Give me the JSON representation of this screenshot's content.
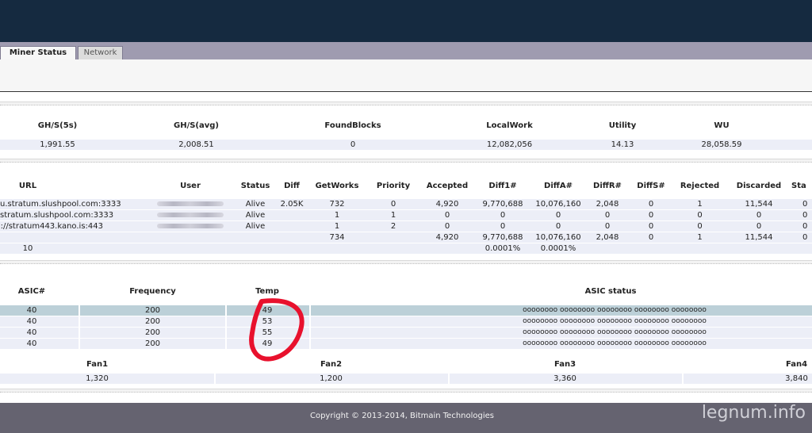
{
  "tabs": [
    {
      "label": "Miner Status",
      "active": true
    },
    {
      "label": "Network",
      "active": false
    }
  ],
  "summary": {
    "headers": [
      "GH/S(5s)",
      "GH/S(avg)",
      "FoundBlocks",
      "LocalWork",
      "Utility",
      "WU"
    ],
    "values": [
      "1,991.55",
      "2,008.51",
      "0",
      "12,082,056",
      "14.13",
      "28,058.59"
    ]
  },
  "pools": {
    "headers": [
      "URL",
      "User",
      "Status",
      "Diff",
      "GetWorks",
      "Priority",
      "Accepted",
      "Diff1#",
      "DiffA#",
      "DiffR#",
      "DiffS#",
      "Rejected",
      "Discarded",
      "Sta"
    ],
    "rows": [
      {
        "url": "u.stratum.slushpool.com:3333",
        "status": "Alive",
        "diff": "2.05K",
        "getworks": "732",
        "priority": "0",
        "accepted": "4,920",
        "diff1": "9,770,688",
        "diffa": "10,076,160",
        "diffr": "2,048",
        "diffs": "0",
        "rejected": "1",
        "discarded": "11,544",
        "sta": "0"
      },
      {
        "url": "stratum.slushpool.com:3333",
        "status": "Alive",
        "diff": "",
        "getworks": "1",
        "priority": "1",
        "accepted": "0",
        "diff1": "0",
        "diffa": "0",
        "diffr": "0",
        "diffs": "0",
        "rejected": "0",
        "discarded": "0",
        "sta": "0"
      },
      {
        "url": "://stratum443.kano.is:443",
        "status": "Alive",
        "diff": "",
        "getworks": "1",
        "priority": "2",
        "accepted": "0",
        "diff1": "0",
        "diffa": "0",
        "diffr": "0",
        "diffs": "0",
        "rejected": "0",
        "discarded": "0",
        "sta": "0"
      }
    ],
    "totals": {
      "getworks": "734",
      "accepted": "4,920",
      "diff1": "9,770,688",
      "diffa": "10,076,160",
      "diffr": "2,048",
      "diffs": "0",
      "rejected": "1",
      "discarded": "11,544",
      "sta": "0"
    },
    "footer": {
      "first": "10",
      "diff1": "0.0001%",
      "diffa": "0.0001%"
    }
  },
  "asic": {
    "headers": [
      "ASIC#",
      "Frequency",
      "Temp",
      "ASIC status"
    ],
    "rows": [
      {
        "asic": "40",
        "freq": "200",
        "temp": "49",
        "status": "oooooooo oooooooo oooooooo oooooooo oooooooo"
      },
      {
        "asic": "40",
        "freq": "200",
        "temp": "53",
        "status": "oooooooo oooooooo oooooooo oooooooo oooooooo"
      },
      {
        "asic": "40",
        "freq": "200",
        "temp": "55",
        "status": "oooooooo oooooooo oooooooo oooooooo oooooooo"
      },
      {
        "asic": "40",
        "freq": "200",
        "temp": "49",
        "status": "oooooooo oooooooo oooooooo oooooooo oooooooo"
      }
    ]
  },
  "fans": {
    "headers": [
      "Fan1",
      "Fan2",
      "Fan3",
      "Fan4"
    ],
    "values": [
      "1,320",
      "1,200",
      "3,360",
      "3,840"
    ]
  },
  "footer": {
    "copyright": "Copyright © 2013-2014, Bitmain Technologies",
    "watermark": "legnum.info"
  },
  "colors": {
    "topbar": "#152a40",
    "tabbar": "#9f9bb0",
    "row": "#eceef7",
    "row_highlight": "#bcd0d8",
    "footer": "#656370",
    "annotation": "#e8112d"
  }
}
